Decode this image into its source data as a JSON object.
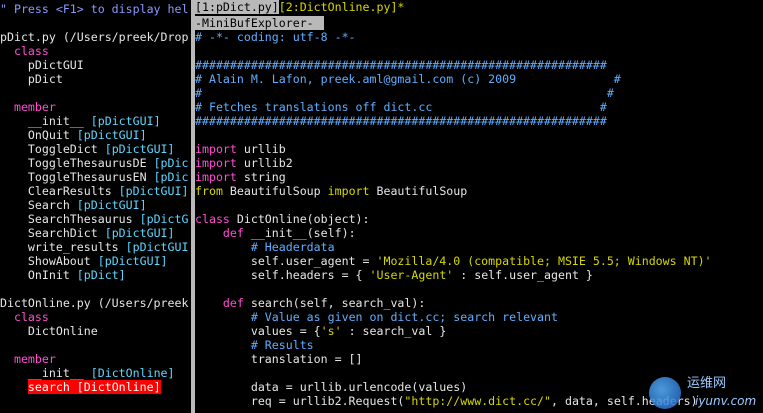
{
  "taglist": {
    "help_line": "\" Press <F1> to display hel",
    "files": [
      {
        "name": "pDict.py (/Users/preek/Drop",
        "groups": [
          {
            "kind": "class",
            "tags": [
              {
                "name": "pDictGUI"
              },
              {
                "name": "pDict"
              }
            ]
          },
          {
            "kind": "member",
            "tags": [
              {
                "name": "__init__",
                "cls": "[pDictGUI]"
              },
              {
                "name": "OnQuit",
                "cls": "[pDictGUI]"
              },
              {
                "name": "ToggleDict",
                "cls": "[pDictGUI]"
              },
              {
                "name": "ToggleThesaurusDE",
                "cls": "[pDic"
              },
              {
                "name": "ToggleThesaurusEN",
                "cls": "[pDic"
              },
              {
                "name": "ClearResults",
                "cls": "[pDictGUI]"
              },
              {
                "name": "Search",
                "cls": "[pDictGUI]"
              },
              {
                "name": "SearchThesaurus",
                "cls": "[pDictG"
              },
              {
                "name": "SearchDict",
                "cls": "[pDictGUI]"
              },
              {
                "name": "write_results",
                "cls": "[pDictGUI"
              },
              {
                "name": "ShowAbout",
                "cls": "[pDictGUI]"
              },
              {
                "name": "OnInit",
                "cls": "[pDict]"
              }
            ]
          }
        ]
      },
      {
        "name": "DictOnline.py (/Users/preek",
        "groups": [
          {
            "kind": "class",
            "tags": [
              {
                "name": "DictOnline"
              }
            ]
          },
          {
            "kind": "member",
            "tags": [
              {
                "name": "__init__",
                "cls": "[DictOnline]"
              },
              {
                "name": "search",
                "cls": "[DictOnline]",
                "selected": true
              }
            ]
          }
        ]
      }
    ]
  },
  "bufexplorer": {
    "active_tab": "[1:pDict.py]",
    "other_tab": "[2:DictOnline.py]*",
    "title": "-MiniBufExplorer-"
  },
  "code_lines": [
    [
      {
        "c": "comment",
        "t": "# -*- coding: utf-8 -*-"
      }
    ],
    [],
    [
      {
        "c": "hashes",
        "t": "###########################################################"
      }
    ],
    [
      {
        "c": "comment",
        "t": "# Alain M. Lafon, preek.aml@gmail.com (c) 2009              #"
      }
    ],
    [
      {
        "c": "comment",
        "t": "#                                                          #"
      }
    ],
    [
      {
        "c": "comment",
        "t": "# Fetches translations off dict.cc                        #"
      }
    ],
    [
      {
        "c": "hashes",
        "t": "###########################################################"
      }
    ],
    [],
    [
      {
        "c": "kw",
        "t": "import"
      },
      {
        "c": "plain",
        "t": " urllib"
      }
    ],
    [
      {
        "c": "kw",
        "t": "import"
      },
      {
        "c": "plain",
        "t": " urllib2"
      }
    ],
    [
      {
        "c": "kw",
        "t": "import"
      },
      {
        "c": "plain",
        "t": " string"
      }
    ],
    [
      {
        "c": "kwy",
        "t": "from"
      },
      {
        "c": "plain",
        "t": " BeautifulSoup "
      },
      {
        "c": "kwy",
        "t": "import"
      },
      {
        "c": "plain",
        "t": " BeautifulSoup"
      }
    ],
    [],
    [
      {
        "c": "kw",
        "t": "class"
      },
      {
        "c": "plain",
        "t": " DictOnline(object):"
      }
    ],
    [
      {
        "c": "plain",
        "t": "    "
      },
      {
        "c": "kw",
        "t": "def"
      },
      {
        "c": "plain",
        "t": " __init__(self):"
      }
    ],
    [
      {
        "c": "plain",
        "t": "        "
      },
      {
        "c": "comment",
        "t": "# Headerdata"
      }
    ],
    [
      {
        "c": "plain",
        "t": "        self.user_agent = "
      },
      {
        "c": "str",
        "t": "'Mozilla/4.0 (compatible; MSIE 5.5; Windows NT)'"
      }
    ],
    [
      {
        "c": "plain",
        "t": "        self.headers = { "
      },
      {
        "c": "str",
        "t": "'User-Agent'"
      },
      {
        "c": "plain",
        "t": " : self.user_agent }"
      }
    ],
    [],
    [
      {
        "c": "plain",
        "t": "    "
      },
      {
        "c": "kw",
        "t": "def"
      },
      {
        "c": "plain",
        "t": " search(self, search_val):"
      }
    ],
    [
      {
        "c": "plain",
        "t": "        "
      },
      {
        "c": "comment",
        "t": "# Value as given on dict.cc; search relevant"
      }
    ],
    [
      {
        "c": "plain",
        "t": "        values = {"
      },
      {
        "c": "str",
        "t": "'s'"
      },
      {
        "c": "plain",
        "t": " : search_val }"
      }
    ],
    [
      {
        "c": "plain",
        "t": "        "
      },
      {
        "c": "comment",
        "t": "# Results"
      }
    ],
    [
      {
        "c": "plain",
        "t": "        translation = []"
      }
    ],
    [],
    [
      {
        "c": "plain",
        "t": "        data = urllib.urlencode(values)"
      }
    ],
    [
      {
        "c": "plain",
        "t": "        req = urllib2.Request("
      },
      {
        "c": "str",
        "t": "\"http://www.dict.cc/\""
      },
      {
        "c": "plain",
        "t": ", data, self.headers)"
      }
    ]
  ],
  "watermark": {
    "text": "运维网",
    "sub": "iyunv.com"
  }
}
